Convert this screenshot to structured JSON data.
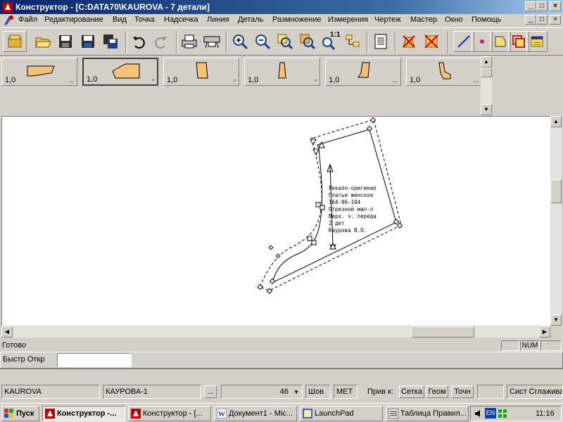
{
  "window": {
    "title": "Конструктор - [C:DATA70\\KAUROVA  - 7 детали]",
    "minimize": "_",
    "maximize": "□",
    "close": "×"
  },
  "menu": [
    "Файл",
    "Редактирование",
    "Вид",
    "Точка",
    "Надсечка",
    "Линия",
    "Деталь",
    "Размножение",
    "Измерения",
    "Чертеж",
    "Мастер",
    "Окно",
    "Помощь"
  ],
  "toolbar": {
    "zoom_actual": "1:1",
    "buttons": [
      "open-folder-icon",
      "save-icon",
      "save-as-icon",
      "save-all-icon",
      "undo-icon",
      "redo-icon",
      "print-icon",
      "plotter-icon",
      "zoom-in-icon",
      "zoom-out-icon",
      "zoom-window-icon",
      "zoom-all-icon",
      "zoom-actual-icon",
      "pan-icon",
      "document-icon",
      "delete-icon",
      "cancel-icon",
      "line-icon",
      "point-icon",
      "piece-icon",
      "layers-icon",
      "table-icon"
    ]
  },
  "pieces": [
    {
      "scale": "1,0",
      "marker": "..."
    },
    {
      "scale": "1,0",
      "marker": "▫"
    },
    {
      "scale": "1,0",
      "marker": "▫"
    },
    {
      "scale": "1,0",
      "marker": "▫"
    },
    {
      "scale": "1,0",
      "marker": "..."
    },
    {
      "scale": "1,0",
      "marker": "..."
    }
  ],
  "annotation": [
    "Лекало-оригинал",
    "Платье женское",
    "164-96-104",
    "Отрезной мал-л",
    "Верх. ч. переда",
    "2 дет",
    "Каурова В.О."
  ],
  "status": {
    "ready": "Готово",
    "num": "NUM",
    "quick_open_label": "Быстр Откр",
    "quick_open_value": ""
  },
  "bottombar": {
    "file": "KAUROVA",
    "piece": "КАУРОВА-1",
    "browse": "...",
    "number": "46",
    "seam": "Шов",
    "units": "МЕТ",
    "snap_label": "Прив к:",
    "grid": "Сетка",
    "geom": "Геом",
    "point": "Точн",
    "smoothing": "Сист Сглажива"
  },
  "taskbar": {
    "start": "Пуск",
    "tasks": [
      "Конструктор -...",
      "Конструктор - [...",
      "Документ1 - Mic...",
      "LaunchPad",
      "Таблица Правил..."
    ],
    "lang": "EN",
    "clock": "11:16"
  },
  "colors": {
    "titlebar": "#0a246a",
    "face": "#d4d0c8",
    "piece_fill": "#f5c27a"
  }
}
